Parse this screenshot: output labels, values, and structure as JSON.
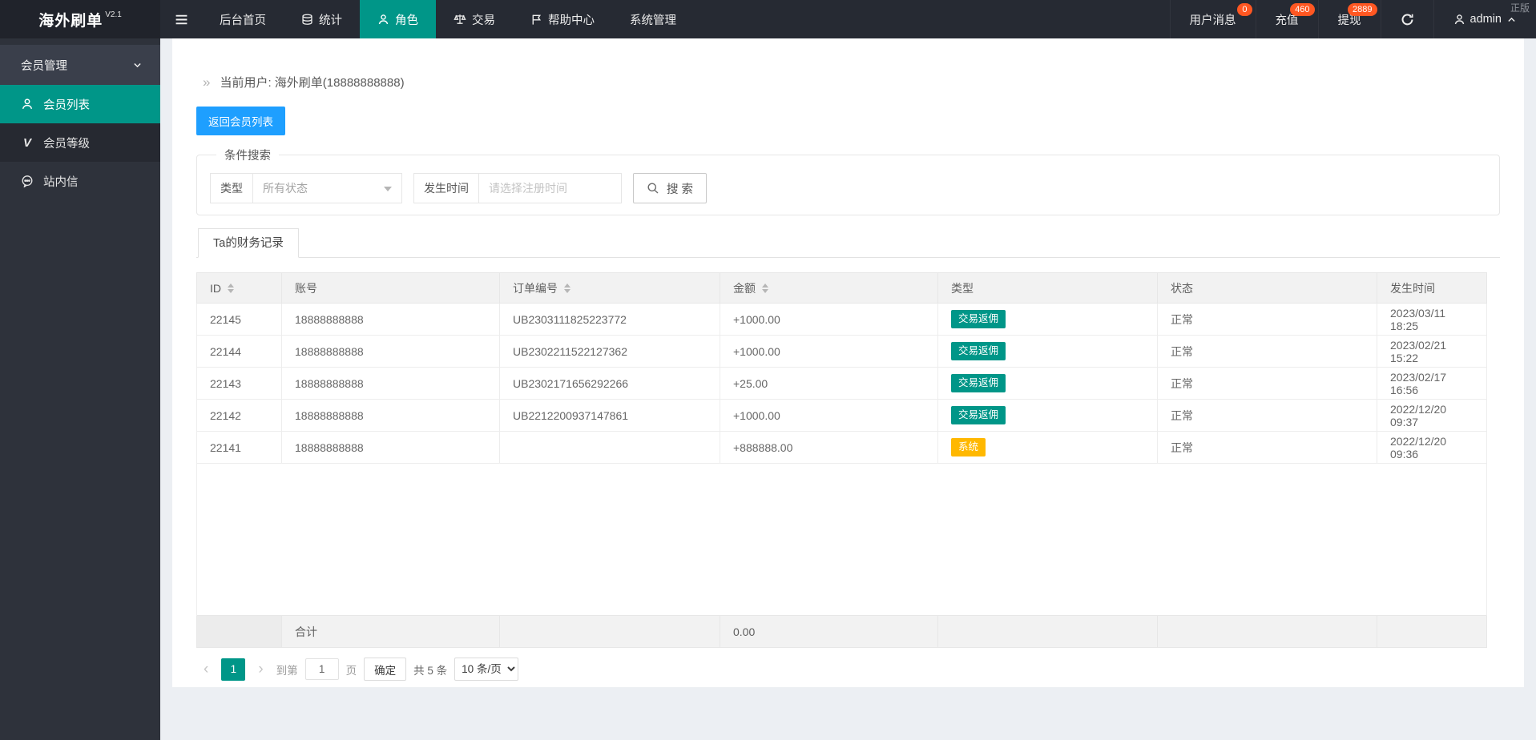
{
  "brand": {
    "name": "海外刷单",
    "version": "V2.1"
  },
  "topbar": {
    "nav": [
      {
        "label": "后台首页"
      },
      {
        "label": "统计"
      },
      {
        "label": "角色",
        "active": true
      },
      {
        "label": "交易"
      },
      {
        "label": "帮助中心"
      },
      {
        "label": "系统管理"
      }
    ],
    "right": {
      "messages": {
        "label": "用户消息",
        "badge": "0"
      },
      "recharge": {
        "label": "充值",
        "badge": "460"
      },
      "withdraw": {
        "label": "提现",
        "badge": "2889"
      },
      "user": "admin",
      "watermark": "正版"
    }
  },
  "sidebar": {
    "group": "会员管理",
    "items": [
      {
        "label": "会员列表",
        "active": true
      },
      {
        "label": "会员等级",
        "icon_glyph": "V"
      },
      {
        "label": "站内信"
      }
    ]
  },
  "main": {
    "breadcrumb_icon": "»",
    "breadcrumb": "当前用户: 海外刷单(18888888888)",
    "back_button": "返回会员列表",
    "search": {
      "legend": "条件搜索",
      "type_label": "类型",
      "type_value": "所有状态",
      "time_label": "发生时间",
      "time_placeholder": "请选择注册时间",
      "submit": "搜 索"
    },
    "tab": "Ta的财务记录",
    "table": {
      "columns": [
        {
          "label": "ID",
          "sortable": true
        },
        {
          "label": "账号",
          "sortable": false
        },
        {
          "label": "订单编号",
          "sortable": true
        },
        {
          "label": "金额",
          "sortable": true
        },
        {
          "label": "类型",
          "sortable": false
        },
        {
          "label": "状态",
          "sortable": false
        },
        {
          "label": "发生时间",
          "sortable": false
        }
      ],
      "rows": [
        {
          "id": "22145",
          "account": "18888888888",
          "order_no": "UB2303111825223772",
          "amount": "+1000.00",
          "type": "交易返佣",
          "type_variant": "teal",
          "status": "正常",
          "time": "2023/03/11 18:25"
        },
        {
          "id": "22144",
          "account": "18888888888",
          "order_no": "UB2302211522127362",
          "amount": "+1000.00",
          "type": "交易返佣",
          "type_variant": "teal",
          "status": "正常",
          "time": "2023/02/21 15:22"
        },
        {
          "id": "22143",
          "account": "18888888888",
          "order_no": "UB2302171656292266",
          "amount": "+25.00",
          "type": "交易返佣",
          "type_variant": "teal",
          "status": "正常",
          "time": "2023/02/17 16:56"
        },
        {
          "id": "22142",
          "account": "18888888888",
          "order_no": "UB2212200937147861",
          "amount": "+1000.00",
          "type": "交易返佣",
          "type_variant": "teal",
          "status": "正常",
          "time": "2022/12/20 09:37"
        },
        {
          "id": "22141",
          "account": "18888888888",
          "order_no": "",
          "amount": "+888888.00",
          "type": "系统",
          "type_variant": "gold",
          "status": "正常",
          "time": "2022/12/20 09:36"
        }
      ],
      "footer": {
        "label": "合计",
        "amount_total": "0.00"
      }
    },
    "pagination": {
      "prev": "‹",
      "next": "›",
      "current": "1",
      "goto_label": "到第",
      "page_input": "1",
      "page_unit": "页",
      "confirm": "确定",
      "total": "共 5 条",
      "page_size": "10 条/页"
    }
  },
  "icons": {
    "menu-fold-icon": "three-bars",
    "database-icon": "stacked-discs",
    "user-icon": "person",
    "scales-icon": "balance",
    "flag-icon": "flag",
    "refresh-icon": "circular-arrow",
    "chevron-up-icon": "chevron-up",
    "chevron-down-icon": "chevron-down",
    "member-level-icon": "letter-v",
    "message-icon": "chat-bubble",
    "search-icon": "magnifier",
    "sort-icon": "up-down-carets",
    "caret-down-icon": "triangle-down",
    "breadcrumb-icon": "double-angle-right"
  },
  "colors": {
    "accent": "#009688",
    "notification_badge": "#FF5722",
    "primary_button": "#1E9FFF",
    "amount_text": "#0BB2A0",
    "system_badge": "#FFB800",
    "topbar_bg": "#262A33",
    "sidebar_bg": "#2E323B"
  }
}
